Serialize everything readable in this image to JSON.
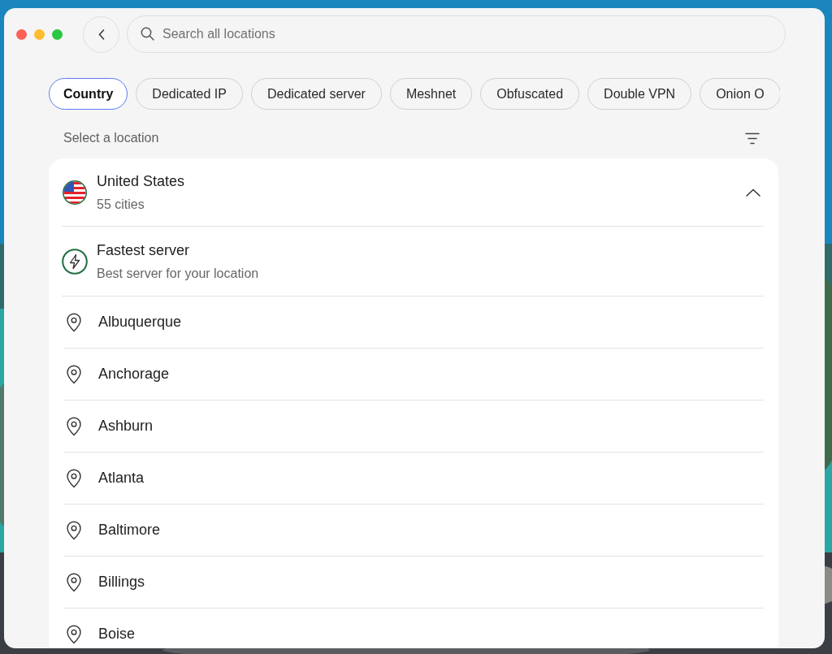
{
  "search": {
    "placeholder": "Search all locations"
  },
  "tabs": [
    {
      "label": "Country",
      "selected": true
    },
    {
      "label": "Dedicated IP",
      "selected": false
    },
    {
      "label": "Dedicated server",
      "selected": false
    },
    {
      "label": "Meshnet",
      "selected": false
    },
    {
      "label": "Obfuscated",
      "selected": false
    },
    {
      "label": "Double VPN",
      "selected": false
    },
    {
      "label": "Onion O",
      "selected": false
    }
  ],
  "section_label": "Select a location",
  "country": {
    "name": "United States",
    "subtitle": "55 cities",
    "expanded": true
  },
  "servers": [
    {
      "kind": "fastest",
      "name": "Fastest server",
      "subtitle": "Best server for your location"
    },
    {
      "kind": "city",
      "name": "Albuquerque"
    },
    {
      "kind": "city",
      "name": "Anchorage"
    },
    {
      "kind": "city",
      "name": "Ashburn"
    },
    {
      "kind": "city",
      "name": "Atlanta"
    },
    {
      "kind": "city",
      "name": "Baltimore"
    },
    {
      "kind": "city",
      "name": "Billings"
    },
    {
      "kind": "city",
      "name": "Boise"
    }
  ]
}
